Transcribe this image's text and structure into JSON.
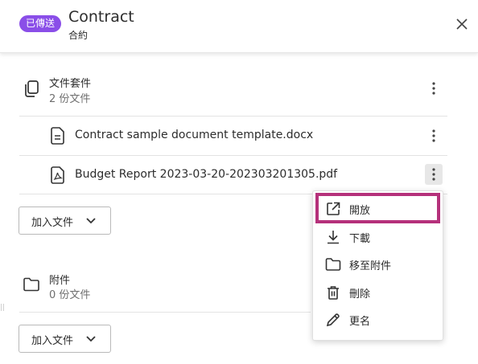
{
  "header": {
    "badge": "已傳送",
    "title": "Contract",
    "subtitle": "合約",
    "close_icon": "close-icon"
  },
  "documents": {
    "title": "文件套件",
    "count": "2 份文件",
    "icon": "copy-icon",
    "files": [
      {
        "name": "Contract sample document template.docx",
        "icon": "document-icon"
      },
      {
        "name": "Budget Report 2023-03-20-202303201305.pdf",
        "icon": "pdf-icon"
      }
    ],
    "add_button": "加入文件"
  },
  "attachments": {
    "title": "附件",
    "count": "0 份文件",
    "icon": "folder-icon",
    "add_button": "加入文件"
  },
  "context_menu": {
    "items": [
      {
        "label": "開放",
        "icon": "open-external-icon",
        "highlighted": true
      },
      {
        "label": "下載",
        "icon": "download-icon"
      },
      {
        "label": "移至附件",
        "icon": "folder-icon"
      },
      {
        "label": "刪除",
        "icon": "trash-icon"
      },
      {
        "label": "更名",
        "icon": "pencil-icon"
      }
    ]
  },
  "colors": {
    "badge": "#8a4ee8",
    "highlight_border": "#b5317b",
    "text": "#2c2c2c",
    "muted_text": "#6e6e6e"
  }
}
